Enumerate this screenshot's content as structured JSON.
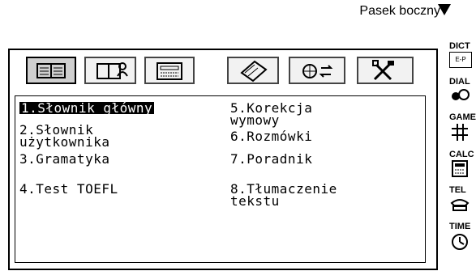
{
  "sidebar_toggle": {
    "label": "Pasek boczny"
  },
  "menu": {
    "items": [
      {
        "label": "1.Słownik główny"
      },
      {
        "label": "2.Słownik\n użytkownika"
      },
      {
        "label": "3.Gramatyka"
      },
      {
        "label": "4.Test TOEFL"
      },
      {
        "label": "5.Korekcja\n  wymowy"
      },
      {
        "label": "6.Rozmówki"
      },
      {
        "label": "7.Poradnik"
      },
      {
        "label": "8.Tłumaczenie\n  tekstu"
      }
    ]
  },
  "sidebar": {
    "items": [
      {
        "label": "DICT",
        "sub": "E-P",
        "icon": "dictionary-icon"
      },
      {
        "label": "DIAL",
        "icon": "dial-icon"
      },
      {
        "label": "GAME",
        "icon": "game-icon"
      },
      {
        "label": "CALC",
        "icon": "calculator-icon"
      },
      {
        "label": "TEL",
        "icon": "telephone-icon"
      },
      {
        "label": "TIME",
        "icon": "clock-icon"
      }
    ]
  },
  "tabs": [
    {
      "icon": "book-icon",
      "active": true
    },
    {
      "icon": "user-book-icon",
      "active": false
    },
    {
      "icon": "keyboard-icon",
      "active": false
    },
    {
      "icon": "notebook-icon",
      "active": false
    },
    {
      "icon": "globe-translate-icon",
      "active": false
    },
    {
      "icon": "tools-icon",
      "active": false
    }
  ]
}
